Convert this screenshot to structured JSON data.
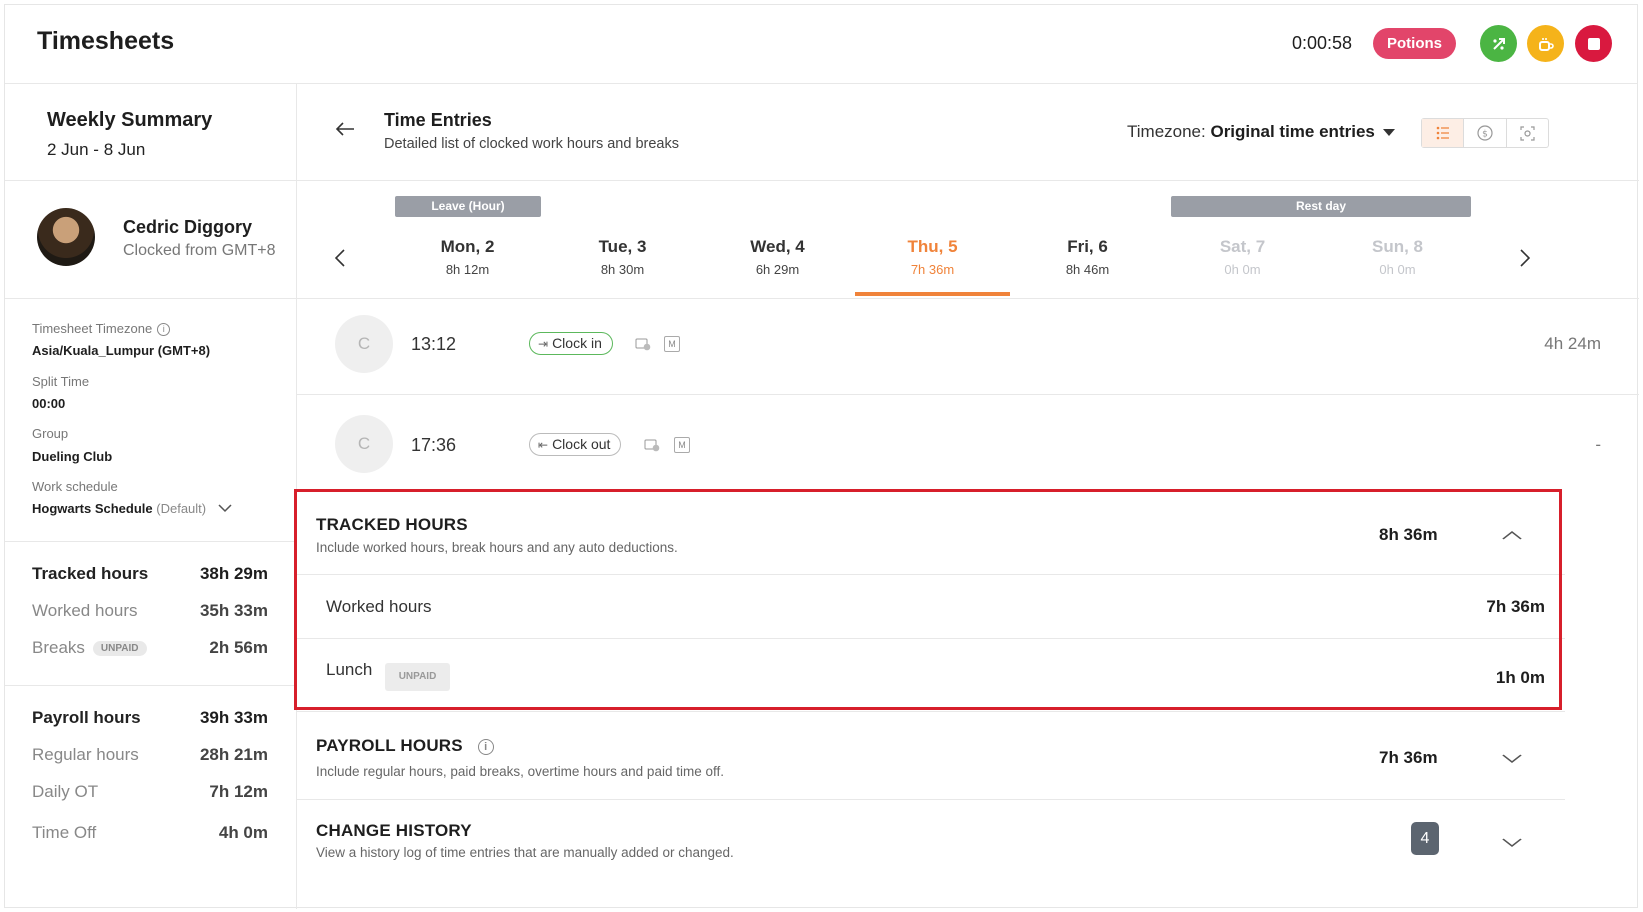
{
  "header": {
    "title": "Timesheets",
    "timer": "0:00:58",
    "potions_label": "Potions"
  },
  "colors": {
    "accent": "#f0833a",
    "potions": "#e2456a",
    "start": "#4bb543",
    "break": "#f5b31a",
    "stop": "#d9193f",
    "highlight": "#d71f2b"
  },
  "summary": {
    "title": "Weekly Summary",
    "range": "2 Jun - 8 Jun"
  },
  "employee": {
    "name": "Cedric Diggory",
    "clocked_from": "Clocked from GMT+8"
  },
  "info": {
    "tz_label": "Timesheet Timezone",
    "tz_value": "Asia/Kuala_Lumpur (GMT+8)",
    "split_label": "Split Time",
    "split_value": "00:00",
    "group_label": "Group",
    "group_value": "Dueling Club",
    "schedule_label": "Work schedule",
    "schedule_value": "Hogwarts Schedule",
    "schedule_default": "(Default)"
  },
  "stats": {
    "tracked_label": "Tracked hours",
    "tracked_value": "38h 29m",
    "worked_label": "Worked hours",
    "worked_value": "35h 33m",
    "breaks_label": "Breaks",
    "breaks_badge": "UNPAID",
    "breaks_value": "2h 56m",
    "payroll_label": "Payroll hours",
    "payroll_value": "39h 33m",
    "regular_label": "Regular hours",
    "regular_value": "28h 21m",
    "dailyot_label": "Daily OT",
    "dailyot_value": "7h 12m",
    "timeoff_label": "Time Off",
    "timeoff_value": "4h 0m"
  },
  "time_entries": {
    "back_icon": "arrow-left-icon",
    "title": "Time Entries",
    "subtitle": "Detailed list of clocked work hours and breaks",
    "timezone_label": "Timezone:",
    "timezone_value": "Original time entries",
    "view_icons": [
      "list-icon",
      "dollar-icon",
      "scan-icon"
    ]
  },
  "week": {
    "leave_tag": "Leave (Hour)",
    "rest_tag": "Rest day",
    "days": [
      {
        "name": "Mon, 2",
        "hours": "8h 12m"
      },
      {
        "name": "Tue, 3",
        "hours": "8h 30m"
      },
      {
        "name": "Wed, 4",
        "hours": "6h 29m"
      },
      {
        "name": "Thu, 5",
        "hours": "7h 36m"
      },
      {
        "name": "Fri, 6",
        "hours": "8h 46m"
      },
      {
        "name": "Sat, 7",
        "hours": "0h 0m"
      },
      {
        "name": "Sun, 8",
        "hours": "0h 0m"
      }
    ]
  },
  "entries": [
    {
      "initial": "C",
      "time": "13:12",
      "action": "Clock in",
      "badge": "M",
      "duration": "4h 24m"
    },
    {
      "initial": "C",
      "time": "17:36",
      "action": "Clock out",
      "badge": "M",
      "duration": "-"
    }
  ],
  "tracked": {
    "title": "TRACKED HOURS",
    "subtitle": "Include worked hours, break hours and any auto deductions.",
    "value": "8h 36m",
    "worked_label": "Worked hours",
    "worked_value": "7h 36m",
    "lunch_label": "Lunch",
    "lunch_badge": "UNPAID",
    "lunch_value": "1h 0m"
  },
  "payroll": {
    "title": "PAYROLL HOURS",
    "subtitle": "Include regular hours, paid breaks, overtime hours and paid time off.",
    "value": "7h 36m"
  },
  "history": {
    "title": "CHANGE HISTORY",
    "subtitle": "View a history log of time entries that are manually added or changed.",
    "count": "4"
  }
}
